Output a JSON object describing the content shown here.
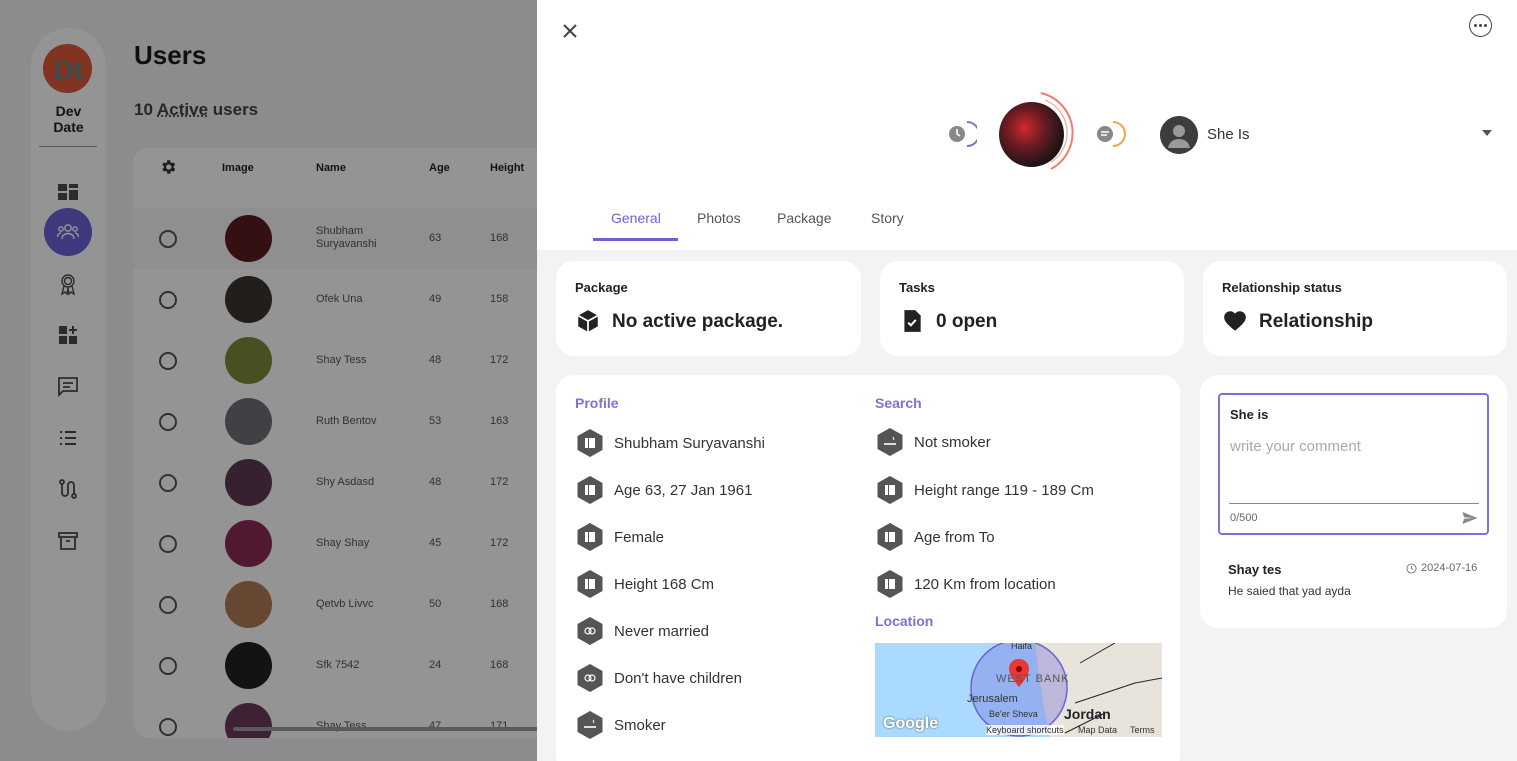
{
  "colors": {
    "accent": "#6c63d8",
    "overlay": "rgba(0,0,0,0.42)",
    "card": "#ffffff",
    "panel_bg": "#f3f3f5"
  },
  "app": {
    "brand": "Dev\nDate",
    "nav": [
      "dashboard-icon",
      "users-icon",
      "award-icon",
      "widgets-icon",
      "chat-icon",
      "list-icon",
      "route-icon",
      "archive-icon"
    ],
    "title": "Users",
    "active_count_prefix": "10 ",
    "active_count_word": "Active",
    "active_count_suffix": " users"
  },
  "table": {
    "headers": {
      "image": "Image",
      "name": "Name",
      "age": "Age",
      "height": "Height"
    },
    "rows": [
      {
        "name": "Shubham Suryavanshi",
        "age": "63",
        "height": "168",
        "avatar": "#5a1c22"
      },
      {
        "name": "Ofek Una",
        "age": "49",
        "height": "158",
        "avatar": "#3b3530"
      },
      {
        "name": "Shay Tess",
        "age": "48",
        "height": "172",
        "avatar": "#7d8a3a"
      },
      {
        "name": "Ruth Bentov",
        "age": "53",
        "height": "163",
        "avatar": "#6f6f78"
      },
      {
        "name": "Shy Asdasd",
        "age": "48",
        "height": "172",
        "avatar": "#5d3a55"
      },
      {
        "name": "Shay Shay",
        "age": "45",
        "height": "172",
        "avatar": "#8a2a55"
      },
      {
        "name": "Qetvb Livvc",
        "age": "50",
        "height": "168",
        "avatar": "#b07a55"
      },
      {
        "name": "Sfk 7542",
        "age": "24",
        "height": "168",
        "avatar": "#222222"
      },
      {
        "name": "Shay Tess",
        "age": "47",
        "height": "171",
        "avatar": "#6b3a5a"
      }
    ]
  },
  "drawer": {
    "selector_label": "She Is",
    "tabs": [
      "General",
      "Photos",
      "Package",
      "Story"
    ],
    "active_tab": "General",
    "package": {
      "label": "Package",
      "value": "No active package."
    },
    "tasks": {
      "label": "Tasks",
      "value": "0 open"
    },
    "relationship": {
      "label": "Relationship status",
      "value": "Relationship"
    },
    "profile": {
      "title": "Profile",
      "items": [
        "Shubham Suryavanshi",
        "Age 63, 27 Jan 1961",
        "Female",
        "Height 168  Cm",
        "Never married",
        "Don't have children",
        "Smoker"
      ]
    },
    "search": {
      "title": "Search",
      "items": [
        "Not smoker",
        "Height range 119  - 189  Cm",
        "Age from   To",
        "120  Km from location"
      ]
    },
    "location": {
      "title": "Location",
      "map_labels": {
        "haifa": "Haifa",
        "west_bank": "WEST BANK",
        "jerusalem": "Jerusalem",
        "beer_sheva": "Be'er Sheva",
        "jordan": "Jordan",
        "google": "Google",
        "shortcuts": "Keyboard shortcuts",
        "map_data": "Map Data",
        "terms": "Terms"
      }
    },
    "comment": {
      "title": "She is",
      "placeholder": "write your comment",
      "counter": "0/500",
      "entries": [
        {
          "author": "Shay tes",
          "date": "2024-07-16",
          "text": "He saied that yad ayda"
        }
      ]
    }
  }
}
